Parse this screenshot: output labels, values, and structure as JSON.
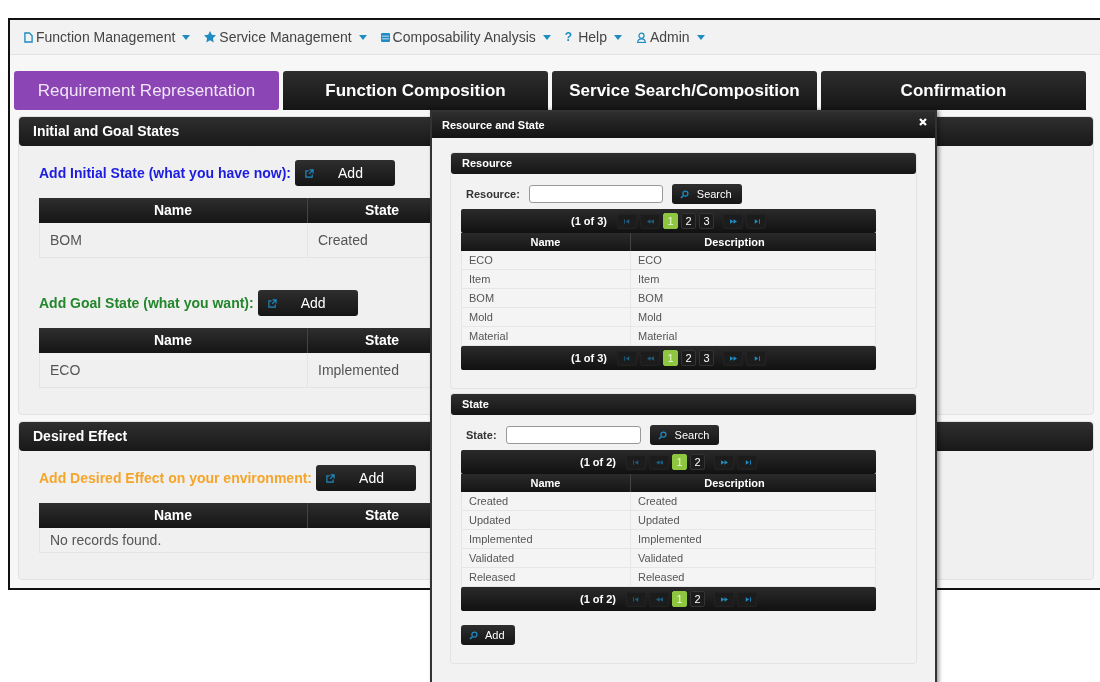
{
  "nav": [
    {
      "kind": "document",
      "label": "Function Management"
    },
    {
      "kind": "star",
      "label": "Service Management"
    },
    {
      "kind": "table",
      "label": "Composability Analysis"
    },
    {
      "kind": "glyph",
      "glyph": "?",
      "label": "Help"
    },
    {
      "kind": "user",
      "label": "Admin"
    }
  ],
  "tabs": [
    {
      "label": "Requirement Representation",
      "selected": true
    },
    {
      "label": "Function Composition",
      "selected": false
    },
    {
      "label": "Service Search/Composition",
      "selected": false
    },
    {
      "label": "Confirmation",
      "selected": false
    }
  ],
  "sections": [
    {
      "title": "Initial and Goal States",
      "groups": [
        {
          "prompt": "Add Initial State (what you have now):",
          "color": "#1c1ce0",
          "button": "Add",
          "columns": [
            "Name",
            "State"
          ],
          "rows": [
            [
              "BOM",
              "Created"
            ]
          ]
        },
        {
          "prompt": "Add Goal State (what you want):",
          "color": "#23862a",
          "button": "Add",
          "columns": [
            "Name",
            "State"
          ],
          "rows": [
            [
              "ECO",
              "Implemented"
            ]
          ]
        }
      ]
    },
    {
      "title": "Desired Effect",
      "groups": [
        {
          "prompt": "Add Desired Effect on your environment:",
          "color": "#f5a52a",
          "button": "Add",
          "columns": [
            "Name",
            "State"
          ],
          "empty_message": "No records found."
        }
      ]
    }
  ],
  "dialog": {
    "title": "Resource and State",
    "panels": [
      {
        "title": "Resource",
        "field_label": "Resource:",
        "search_button": "Search",
        "pager_top": {
          "summary": "(1 of 3)",
          "pages": [
            {
              "label": "1",
              "selected": true
            },
            {
              "label": "2",
              "selected": false
            },
            {
              "label": "3",
              "selected": false
            }
          ]
        },
        "columns": [
          "Name",
          "Description"
        ],
        "rows": [
          [
            "ECO",
            "ECO"
          ],
          [
            "Item",
            "Item"
          ],
          [
            "BOM",
            "BOM"
          ],
          [
            "Mold",
            "Mold"
          ],
          [
            "Material",
            "Material"
          ]
        ],
        "pager_bottom": {
          "summary": "(1 of 3)",
          "pages": [
            {
              "label": "1",
              "selected": true
            },
            {
              "label": "2",
              "selected": false
            },
            {
              "label": "3",
              "selected": false
            }
          ]
        }
      },
      {
        "title": "State",
        "field_label": "State:",
        "search_button": "Search",
        "pager_top": {
          "summary": "(1 of 2)",
          "pages": [
            {
              "label": "1",
              "selected": true
            },
            {
              "label": "2",
              "selected": false
            }
          ]
        },
        "columns": [
          "Name",
          "Description"
        ],
        "rows": [
          [
            "Created",
            "Created"
          ],
          [
            "Updated",
            "Updated"
          ],
          [
            "Implemented",
            "Implemented"
          ],
          [
            "Validated",
            "Validated"
          ],
          [
            "Released",
            "Released"
          ]
        ],
        "pager_bottom": {
          "summary": "(1 of 2)",
          "pages": [
            {
              "label": "1",
              "selected": true
            },
            {
              "label": "2",
              "selected": false
            }
          ]
        }
      }
    ],
    "add_button": "Add"
  }
}
